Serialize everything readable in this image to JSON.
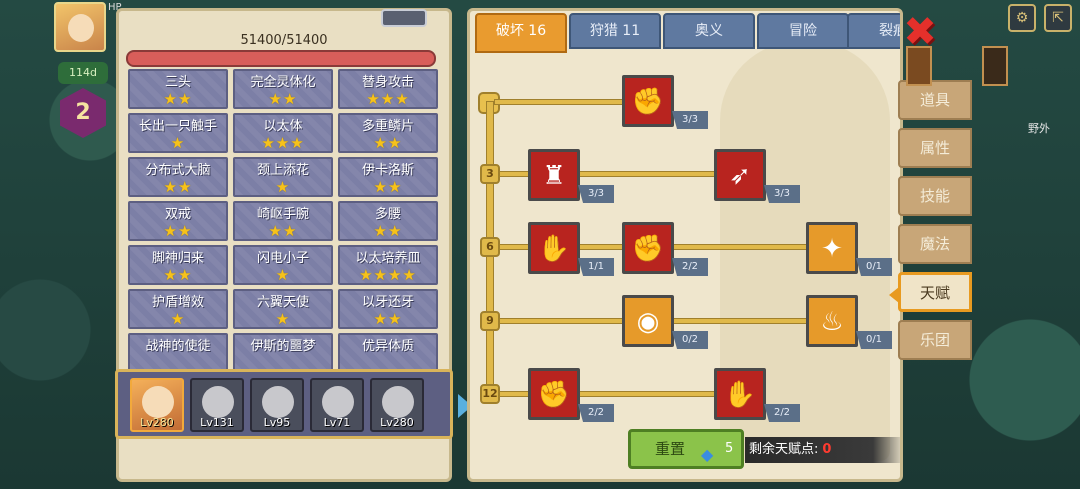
{
  "hud": {
    "level_badge": "114d",
    "hex_number": "2",
    "small_text": "HP"
  },
  "left_panel": {
    "hp_text": "51400/51400",
    "abilities": [
      {
        "name": "三头",
        "stars": 2
      },
      {
        "name": "完全灵体化",
        "stars": 2
      },
      {
        "name": "替身攻击",
        "stars": 3
      },
      {
        "name": "长出一只触手",
        "stars": 1
      },
      {
        "name": "以太体",
        "stars": 3
      },
      {
        "name": "多重鳞片",
        "stars": 2
      },
      {
        "name": "分布式大脑",
        "stars": 2
      },
      {
        "name": "颈上添花",
        "stars": 1
      },
      {
        "name": "伊卡洛斯",
        "stars": 2
      },
      {
        "name": "双戒",
        "stars": 2
      },
      {
        "name": "崎岖手腕",
        "stars": 2
      },
      {
        "name": "多腰",
        "stars": 2
      },
      {
        "name": "脚神归来",
        "stars": 2
      },
      {
        "name": "闪电小子",
        "stars": 1
      },
      {
        "name": "以太培养皿",
        "stars": 4
      },
      {
        "name": "护盾增效",
        "stars": 1
      },
      {
        "name": "六翼天使",
        "stars": 1
      },
      {
        "name": "以牙还牙",
        "stars": 2
      },
      {
        "name": "战神的使徒",
        "stars": 0
      },
      {
        "name": "伊斯的噩梦",
        "stars": 0
      },
      {
        "name": "优异体质",
        "stars": 0
      }
    ],
    "heroes": [
      {
        "level": "Lv280",
        "selected": true
      },
      {
        "level": "Lv131",
        "selected": false
      },
      {
        "level": "Lv95",
        "selected": false
      },
      {
        "level": "Lv71",
        "selected": false
      },
      {
        "level": "Lv280",
        "selected": false
      }
    ]
  },
  "tabs": [
    {
      "label": "破坏 16",
      "active": true
    },
    {
      "label": "狩猎 11",
      "active": false
    },
    {
      "label": "奥义",
      "active": false
    },
    {
      "label": "冒险",
      "active": false
    },
    {
      "label": "裂痕",
      "active": false
    }
  ],
  "tiers": [
    "3",
    "6",
    "9",
    "12"
  ],
  "talents": [
    {
      "icon": "arm-wrestle-icon",
      "glyph": "✊",
      "count": "3/3",
      "style": "red"
    },
    {
      "icon": "muscle-body-icon",
      "glyph": "♜",
      "count": "3/3",
      "style": "red"
    },
    {
      "icon": "arrow-hit-icon",
      "glyph": "➶",
      "count": "3/3",
      "style": "red"
    },
    {
      "icon": "card-hand-icon",
      "glyph": "✋",
      "count": "1/1",
      "style": "red"
    },
    {
      "icon": "fist-punch-icon",
      "glyph": "✊",
      "count": "2/2",
      "style": "red"
    },
    {
      "icon": "splash-icon",
      "glyph": "✦",
      "count": "0/1",
      "style": "orange"
    },
    {
      "icon": "ring-ripple-icon",
      "glyph": "◉",
      "count": "0/2",
      "style": "orange"
    },
    {
      "icon": "flame-wing-icon",
      "glyph": "♨",
      "count": "0/1",
      "style": "orange"
    },
    {
      "icon": "raised-fist-icon",
      "glyph": "✊",
      "count": "2/2",
      "style": "red"
    },
    {
      "icon": "open-palm-icon",
      "glyph": "✋",
      "count": "2/2",
      "style": "red"
    }
  ],
  "reset": {
    "label": "重置",
    "cost": "5"
  },
  "remaining": {
    "label": "剩余天赋点:",
    "value": "0"
  },
  "side_menu": [
    {
      "label": "道具",
      "active": false
    },
    {
      "label": "属性",
      "active": false
    },
    {
      "label": "技能",
      "active": false
    },
    {
      "label": "魔法",
      "active": false
    },
    {
      "label": "天赋",
      "active": true
    },
    {
      "label": "乐团",
      "active": false
    }
  ],
  "field_label": "野外",
  "colors": {
    "active_tab": "#e99b2f",
    "tab": "#5f79a0",
    "star": "#f6c21b",
    "talent_red": "#b8241f",
    "talent_orange": "#e69a2a"
  }
}
